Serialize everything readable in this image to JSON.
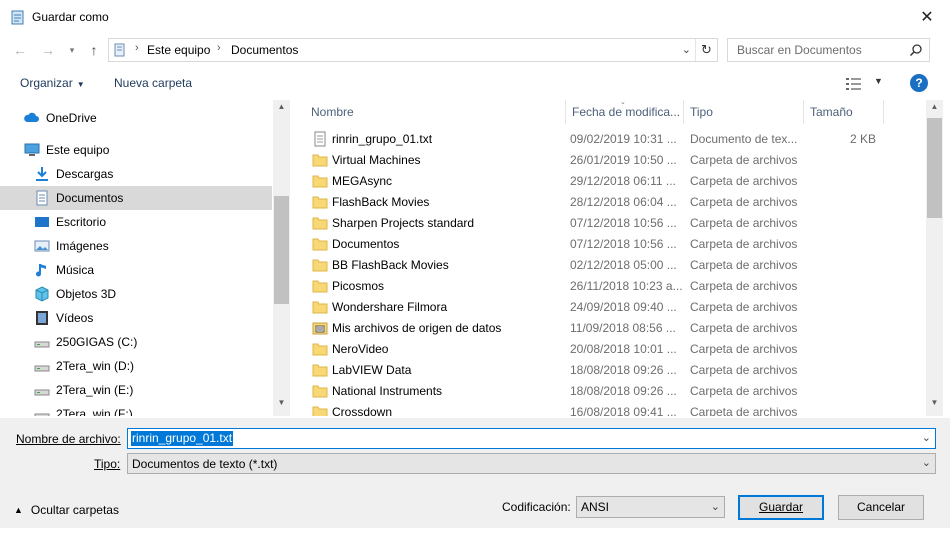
{
  "window": {
    "title": "Guardar como",
    "close_glyph": "✕"
  },
  "address": {
    "crumbs": [
      "Este equipo",
      "Documentos"
    ],
    "separator": "›",
    "search_placeholder": "Buscar en Documentos"
  },
  "toolbar": {
    "organize": "Organizar",
    "new_folder": "Nueva carpeta",
    "help": "?"
  },
  "nav": {
    "items": [
      {
        "label": "OneDrive",
        "icon": "cloud-icon"
      },
      {
        "label": "Este equipo",
        "icon": "computer-icon"
      },
      {
        "label": "Descargas",
        "icon": "download-icon"
      },
      {
        "label": "Documentos",
        "icon": "document-icon",
        "selected": true
      },
      {
        "label": "Escritorio",
        "icon": "desktop-icon"
      },
      {
        "label": "Imágenes",
        "icon": "image-icon"
      },
      {
        "label": "Música",
        "icon": "music-icon"
      },
      {
        "label": "Objetos 3D",
        "icon": "cube-icon"
      },
      {
        "label": "Vídeos",
        "icon": "video-icon"
      },
      {
        "label": "250GIGAS (C:)",
        "icon": "drive-icon"
      },
      {
        "label": "2Tera_win (D:)",
        "icon": "drive-icon"
      },
      {
        "label": "2Tera_win (E:)",
        "icon": "drive-icon"
      },
      {
        "label": "2Tera_win (F:)",
        "icon": "drive-icon"
      }
    ]
  },
  "columns": {
    "name": "Nombre",
    "date": "Fecha de modifica...",
    "type": "Tipo",
    "size": "Tamaño"
  },
  "files": [
    {
      "name": "rinrin_grupo_01.txt",
      "date": "09/02/2019 10:31 ...",
      "type": "Documento de tex...",
      "size": "2 KB",
      "kind": "text"
    },
    {
      "name": "Virtual Machines",
      "date": "26/01/2019 10:50 ...",
      "type": "Carpeta de archivos",
      "size": "",
      "kind": "folder"
    },
    {
      "name": "MEGAsync",
      "date": "29/12/2018 06:11 ...",
      "type": "Carpeta de archivos",
      "size": "",
      "kind": "folder"
    },
    {
      "name": "FlashBack Movies",
      "date": "28/12/2018 06:04 ...",
      "type": "Carpeta de archivos",
      "size": "",
      "kind": "folder"
    },
    {
      "name": "Sharpen Projects standard",
      "date": "07/12/2018 10:56 ...",
      "type": "Carpeta de archivos",
      "size": "",
      "kind": "folder"
    },
    {
      "name": "Documentos",
      "date": "07/12/2018 10:56 ...",
      "type": "Carpeta de archivos",
      "size": "",
      "kind": "folder"
    },
    {
      "name": "BB FlashBack Movies",
      "date": "02/12/2018 05:00 ...",
      "type": "Carpeta de archivos",
      "size": "",
      "kind": "folder"
    },
    {
      "name": "Picosmos",
      "date": "26/11/2018 10:23 a...",
      "type": "Carpeta de archivos",
      "size": "",
      "kind": "folder"
    },
    {
      "name": "Wondershare Filmora",
      "date": "24/09/2018 09:40 ...",
      "type": "Carpeta de archivos",
      "size": "",
      "kind": "folder"
    },
    {
      "name": "Mis archivos de origen de datos",
      "date": "11/09/2018 08:56 ...",
      "type": "Carpeta de archivos",
      "size": "",
      "kind": "datafolder"
    },
    {
      "name": "NeroVideo",
      "date": "20/08/2018 10:01 ...",
      "type": "Carpeta de archivos",
      "size": "",
      "kind": "folder"
    },
    {
      "name": "LabVIEW Data",
      "date": "18/08/2018 09:26 ...",
      "type": "Carpeta de archivos",
      "size": "",
      "kind": "folder"
    },
    {
      "name": "National Instruments",
      "date": "18/08/2018 09:26 ...",
      "type": "Carpeta de archivos",
      "size": "",
      "kind": "folder"
    },
    {
      "name": "Crossdown",
      "date": "16/08/2018 09:41 ...",
      "type": "Carpeta de archivos",
      "size": "",
      "kind": "folder"
    }
  ],
  "form": {
    "filename_label": "Nombre de archivo:",
    "filename_value": "rinrin_grupo_01.txt",
    "type_label": "Tipo:",
    "type_value": "Documentos de texto (*.txt)",
    "encoding_label": "Codificación:",
    "encoding_value": "ANSI",
    "save": "Guardar",
    "cancel": "Cancelar",
    "hide_folders": "Ocultar carpetas"
  },
  "colors": {
    "accent": "#0078d7",
    "selected_nav": "#d9d9d9",
    "folder": "#f8d775",
    "header_text": "#4c607a"
  }
}
